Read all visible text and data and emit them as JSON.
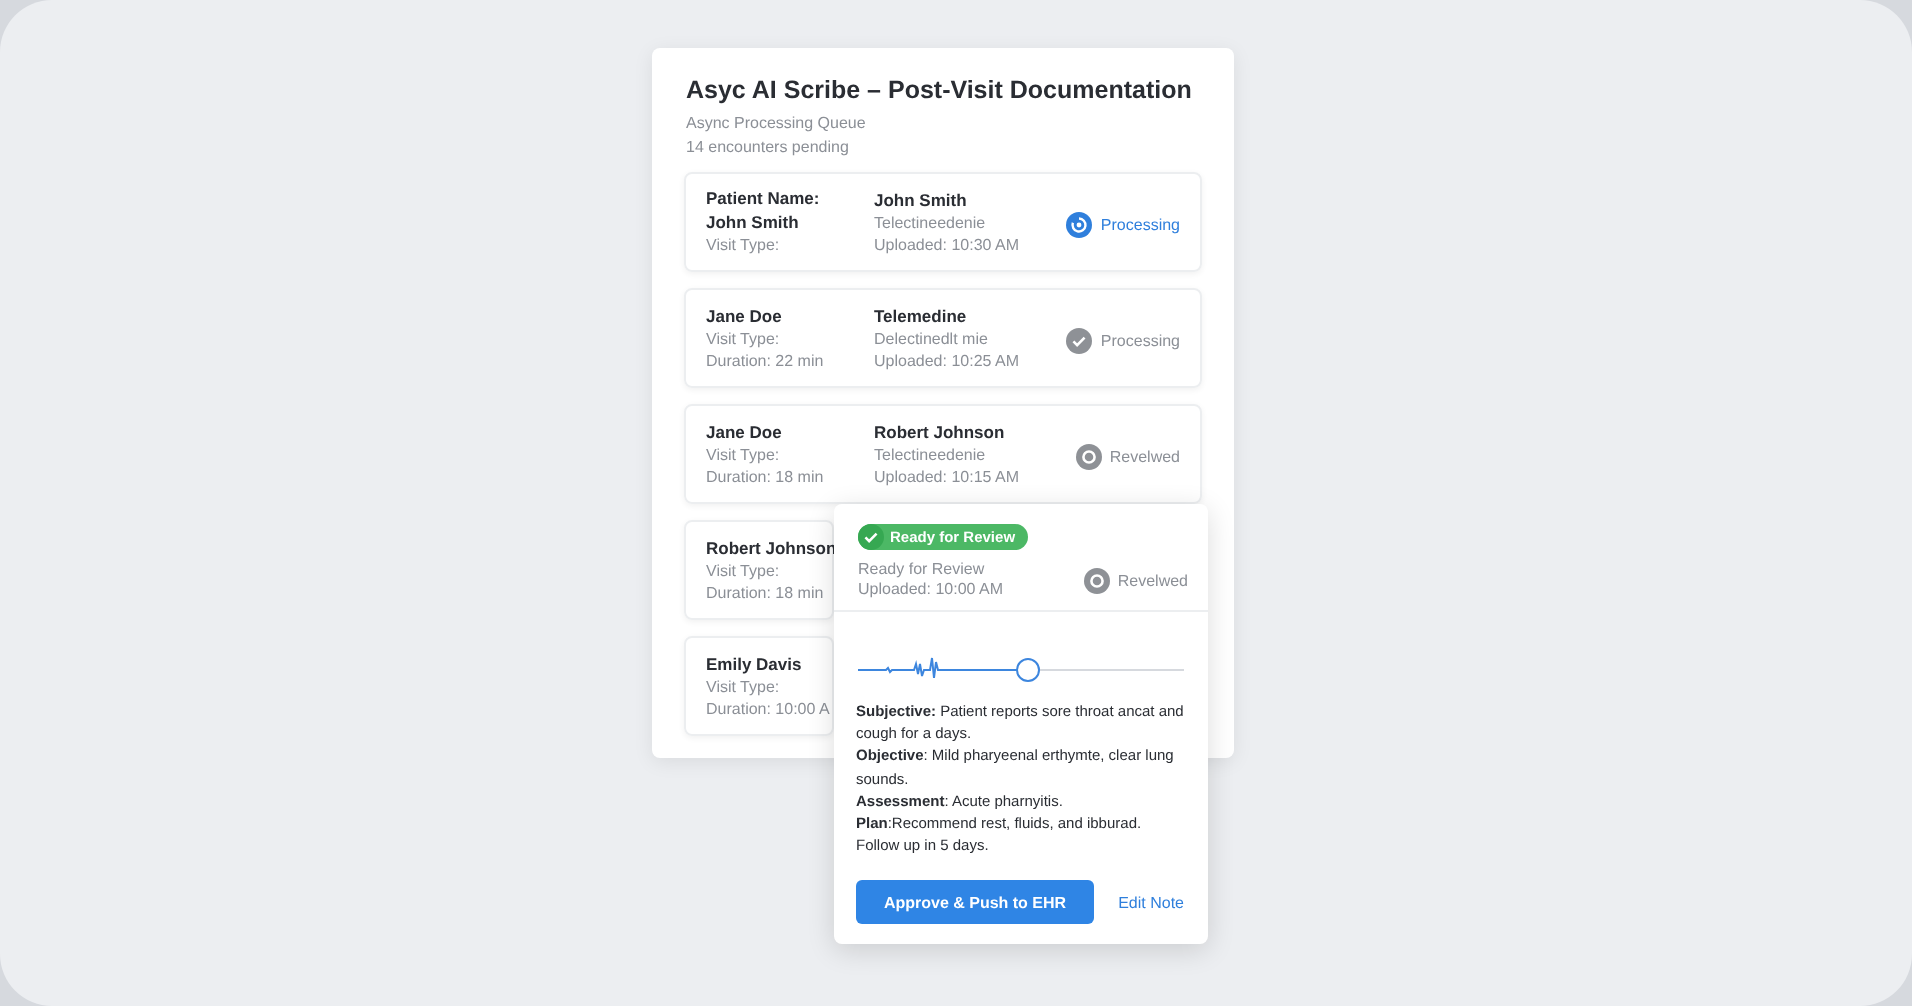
{
  "title": "Asyc AI Scribe – Post-Visit Documentation",
  "subtitle": "Async Processing Queue",
  "count": "14 encounters pending",
  "encounters": [
    {
      "left": [
        {
          "text": "Patient Name:",
          "strong": true
        },
        {
          "text": "John Smith",
          "strong": true
        },
        {
          "text": "Visit Type:",
          "strong": false
        }
      ],
      "right": [
        {
          "text": "John Smith",
          "strong": true
        },
        {
          "text": "Telectineedenie",
          "strong": false
        },
        {
          "text": "Uploaded: 10:30 AM",
          "strong": false
        }
      ],
      "status": {
        "label": "Processing",
        "kind": "spinner",
        "active": true
      }
    },
    {
      "left": [
        {
          "text": "Jane Doe",
          "strong": true
        },
        {
          "text": "Visit Type:",
          "strong": false
        },
        {
          "text": "Duration: 22 min",
          "strong": false
        }
      ],
      "right": [
        {
          "text": "Telemedine",
          "strong": true
        },
        {
          "text": "Delectinedlt mie",
          "strong": false
        },
        {
          "text": "Uploaded: 10:25 AM",
          "strong": false
        }
      ],
      "status": {
        "label": "Processing",
        "kind": "check",
        "active": false
      }
    },
    {
      "left": [
        {
          "text": "Jane Doe",
          "strong": true
        },
        {
          "text": "Visit Type:",
          "strong": false
        },
        {
          "text": "Duration: 18 min",
          "strong": false
        }
      ],
      "right": [
        {
          "text": "Robert Johnson",
          "strong": true
        },
        {
          "text": "Telectineedenie",
          "strong": false
        },
        {
          "text": "Uploaded: 10:15 AM",
          "strong": false
        }
      ],
      "status": {
        "label": "Revelwed",
        "kind": "ring",
        "active": false
      }
    },
    {
      "left": [
        {
          "text": "Robert Johnson",
          "strong": true
        },
        {
          "text": "Visit Type:",
          "strong": false
        },
        {
          "text": "Duration: 18 min",
          "strong": false
        }
      ]
    },
    {
      "left": [
        {
          "text": "Emily Davis",
          "strong": true
        },
        {
          "text": "Visit Type:",
          "strong": false
        },
        {
          "text": "Duration: 10:00 A",
          "strong": false
        }
      ]
    }
  ],
  "review": {
    "badge": "Ready for Review",
    "lines": [
      "Ready for Review",
      "Uploaded: 10:00 AM"
    ],
    "status": {
      "label": "Revelwed",
      "kind": "ring",
      "active": false
    },
    "note": [
      "**Subjective:** Patient reports sore throat ancat and cough for a days.",
      "**Objective**: Mild pharyeenal erthymte, clear lung sounds.",
      "**Assessment**: Acute pharnyitis.",
      "**Plan**:Recommend rest, fluids, and ibburad. Follow up in 5 days."
    ],
    "approve": "Approve & Push to EHR",
    "edit": "Edit Note"
  }
}
